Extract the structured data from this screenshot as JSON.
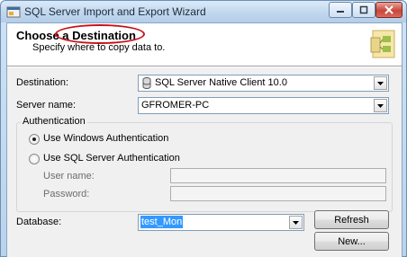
{
  "window": {
    "title": "SQL Server Import and Export Wizard"
  },
  "header": {
    "title": "Choose a Destination",
    "subtitle": "Specify where to copy data to."
  },
  "form": {
    "destination_label": "Destination:",
    "destination_value": "SQL Server Native Client 10.0",
    "server_name_label": "Server name:",
    "server_name_value": "GFROMER-PC",
    "authentication_caption": "Authentication",
    "windows_auth_label": "Use Windows Authentication",
    "windows_auth_checked": true,
    "sql_auth_label": "Use SQL Server Authentication",
    "sql_auth_checked": false,
    "user_name_label": "User name:",
    "password_label": "Password:",
    "database_label": "Database:",
    "database_value": "test_Mon",
    "refresh_label": "Refresh",
    "new_label": "New..."
  },
  "icons": [
    "app-icon",
    "minimize-icon",
    "maximize-icon",
    "close-icon",
    "database-icon",
    "dropdown-arrow-icon",
    "wizard-graphic"
  ],
  "colors": {
    "highlight_ring": "#c8101a",
    "selection": "#3399ff",
    "titlebar": "#c3d9ef"
  }
}
